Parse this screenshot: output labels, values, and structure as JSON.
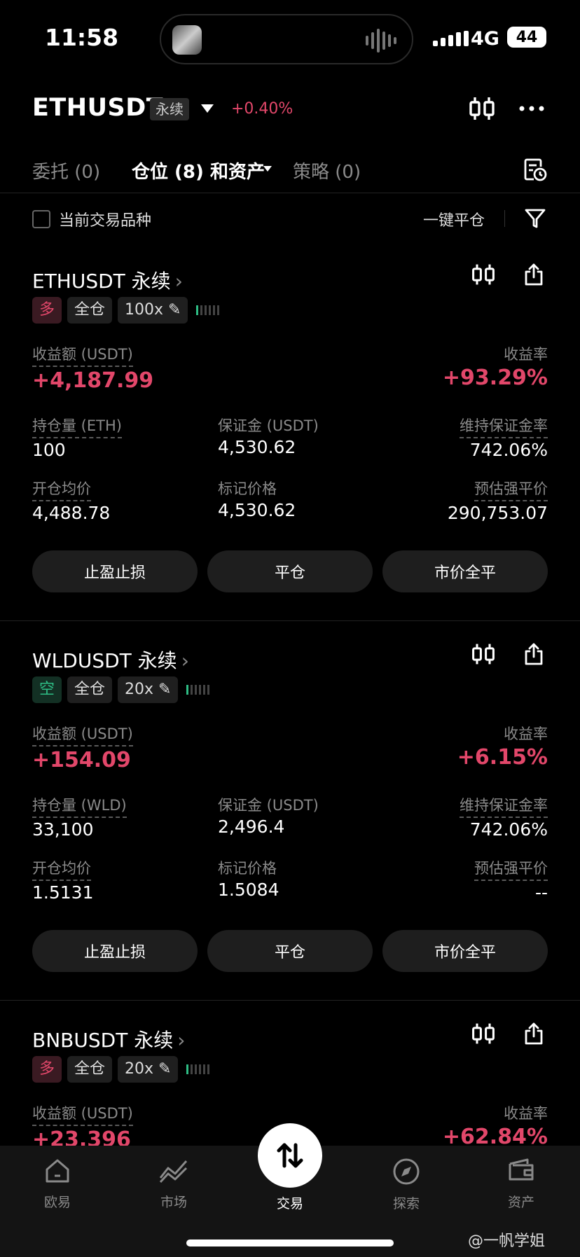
{
  "status_bar": {
    "time": "11:58",
    "network": "4G",
    "battery": "44"
  },
  "header": {
    "symbol": "ETHUSDT",
    "contract_type": "永续",
    "change": "+0.40%"
  },
  "tabs": [
    {
      "label": "委托 (0)",
      "active": false
    },
    {
      "label": "仓位 (8) 和资产",
      "active": true
    },
    {
      "label": "策略 (0)",
      "active": false
    }
  ],
  "filter": {
    "checkbox_label": "当前交易品种",
    "close_all": "一键平仓"
  },
  "labels": {
    "pnl": "收益额 (USDT)",
    "roe": "收益率",
    "margin": "保证金 (USDT)",
    "maint_ratio": "维持保证金率",
    "entry_price": "开仓均价",
    "mark_price": "标记价格",
    "liq_price": "预估强平价"
  },
  "positions": [
    {
      "title": "ETHUSDT 永续",
      "side": "多",
      "margin_mode": "全仓",
      "leverage": "100x",
      "pnl": "+4,187.99",
      "roe": "+93.29%",
      "size_label": "持仓量 (ETH)",
      "size": "100",
      "margin": "4,530.62",
      "maint_ratio": "742.06%",
      "entry_price": "4,488.78",
      "mark_price": "4,530.62",
      "liq_price": "290,753.07",
      "buttons": [
        "止盈止损",
        "平仓",
        "市价全平"
      ]
    },
    {
      "title": "WLDUSDT 永续",
      "side": "空",
      "margin_mode": "全仓",
      "leverage": "20x",
      "pnl": "+154.09",
      "roe": "+6.15%",
      "size_label": "持仓量 (WLD)",
      "size": "33,100",
      "margin": "2,496.4",
      "maint_ratio": "742.06%",
      "entry_price": "1.5131",
      "mark_price": "1.5084",
      "liq_price": "--",
      "buttons": [
        "止盈止损",
        "平仓",
        "市价全平"
      ]
    },
    {
      "title": "BNBUSDT 永续",
      "side": "多",
      "margin_mode": "全仓",
      "leverage": "20x",
      "pnl": "+23.396",
      "roe": "+62.84%"
    }
  ],
  "nav": [
    {
      "label": "欧易",
      "icon": "home-icon"
    },
    {
      "label": "市场",
      "icon": "market-chart-icon"
    },
    {
      "label": "交易",
      "icon": "trade-swap-icon",
      "active": true
    },
    {
      "label": "探索",
      "icon": "compass-icon"
    },
    {
      "label": "资产",
      "icon": "wallet-icon"
    }
  ],
  "watermark": "@一帆学姐",
  "colors": {
    "profit": "#e2476a",
    "short": "#2ebd85",
    "background": "#000000"
  }
}
